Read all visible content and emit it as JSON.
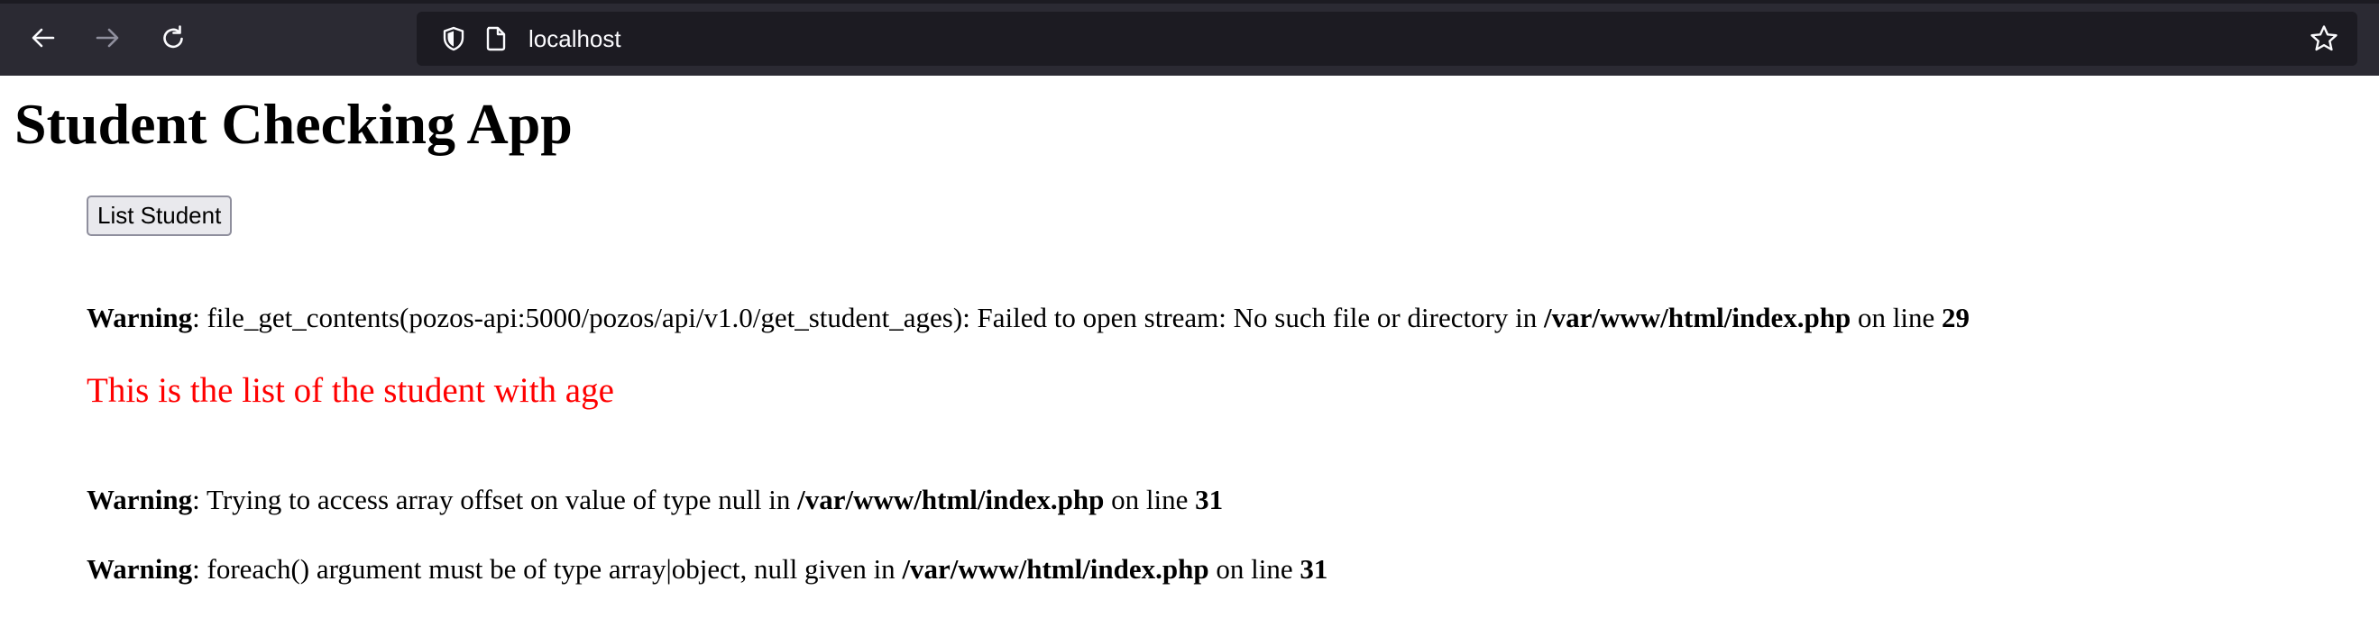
{
  "browser": {
    "url": "localhost",
    "icons": {
      "back": "arrow-left-icon",
      "forward": "arrow-right-icon",
      "reload": "reload-icon",
      "shield": "shield-icon",
      "page": "page-icon",
      "bookmark": "star-icon"
    },
    "colors": {
      "toolbar": "#2b2a33",
      "urlbar": "#1c1b22",
      "icon": "#fbfbfe",
      "icon_disabled": "#8f8f9d"
    }
  },
  "page": {
    "title": "Student Checking App",
    "list_button_label": "List Student",
    "warnings": [
      {
        "label": "Warning",
        "sep": ": ",
        "message": "file_get_contents(pozos-api:5000/pozos/api/v1.0/get_student_ages): Failed to open stream: No such file or directory in ",
        "file": "/var/www/html/index.php",
        "on_line": " on line ",
        "line": "29"
      },
      {
        "label": "Warning",
        "sep": ": ",
        "message": "Trying to access array offset on value of type null in ",
        "file": "/var/www/html/index.php",
        "on_line": " on line ",
        "line": "31"
      },
      {
        "label": "Warning",
        "sep": ": ",
        "message": "foreach() argument must be of type array|object, null given in ",
        "file": "/var/www/html/index.php",
        "on_line": " on line ",
        "line": "31"
      }
    ],
    "list_heading": "This is the list of the student with age",
    "colors": {
      "list_heading": "#ff0000"
    }
  }
}
